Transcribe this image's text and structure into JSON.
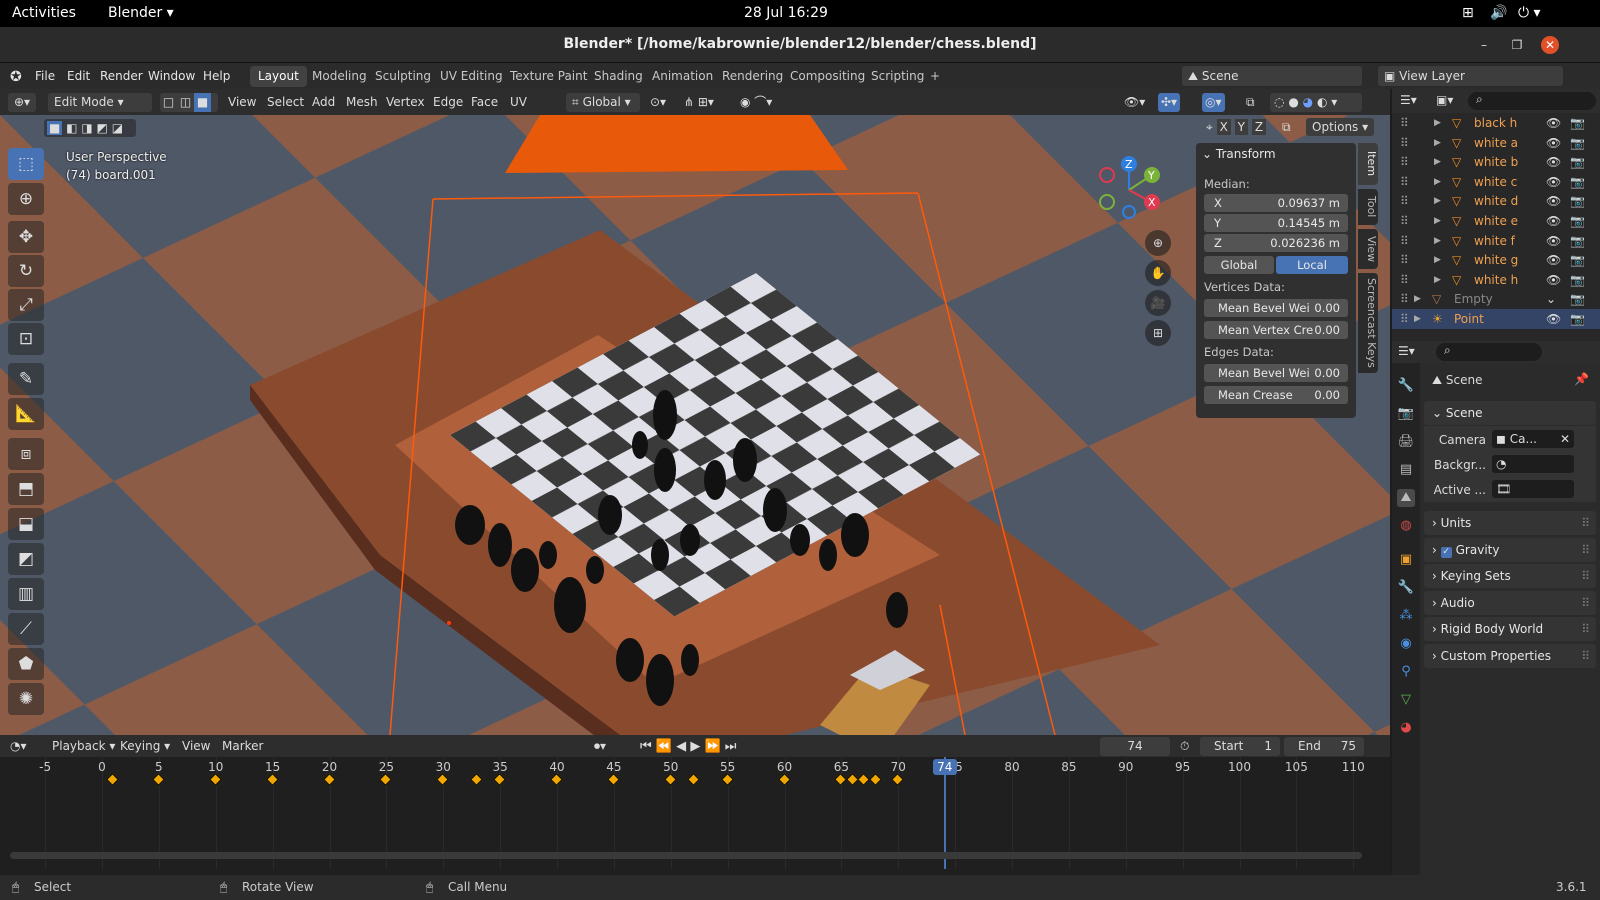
{
  "gnome": {
    "activities": "Activities",
    "app": "Blender ▾",
    "clock": "28 Jul  16:29"
  },
  "title": "Blender* [/home/kabrownie/blender12/blender/chess.blend]",
  "menus": [
    "File",
    "Edit",
    "Render",
    "Window",
    "Help"
  ],
  "workspaces": [
    "Layout",
    "Modeling",
    "Sculpting",
    "UV Editing",
    "Texture Paint",
    "Shading",
    "Animation",
    "Rendering",
    "Compositing",
    "Scripting"
  ],
  "scene_field": "Scene",
  "view_layer_field": "View Layer",
  "header": {
    "mode": "Edit Mode",
    "view": "View",
    "select": "Select",
    "add": "Add",
    "mesh": "Mesh",
    "vertex": "Vertex",
    "edge": "Edge",
    "face": "Face",
    "uv": "UV",
    "orientation": "Global",
    "options": "Options",
    "x": "X",
    "y": "Y",
    "z": "Z"
  },
  "viewport": {
    "perspective": "User Perspective",
    "object": "(74) board.001"
  },
  "npanel": {
    "title": "Transform",
    "median": "Median:",
    "x_label": "X",
    "x_value": "0.09637 m",
    "y_label": "Y",
    "y_value": "0.14545 m",
    "z_label": "Z",
    "z_value": "0.026236 m",
    "global": "Global",
    "local": "Local",
    "vertices_data": "Vertices Data:",
    "v_bevel": "Mean Bevel Wei",
    "v_bevel_val": "0.00",
    "v_crease": "Mean Vertex Cre",
    "v_crease_val": "0.00",
    "edges_data": "Edges Data:",
    "e_bevel": "Mean Bevel Wei",
    "e_bevel_val": "0.00",
    "e_crease": "Mean Crease",
    "e_crease_val": "0.00"
  },
  "sidetabs": [
    "Item",
    "Tool",
    "View",
    "Screencast Keys"
  ],
  "outliner": [
    {
      "name": "black h"
    },
    {
      "name": "white a"
    },
    {
      "name": "white b"
    },
    {
      "name": "white c"
    },
    {
      "name": "white d"
    },
    {
      "name": "white e"
    },
    {
      "name": "white f"
    },
    {
      "name": "white g"
    },
    {
      "name": "white h"
    },
    {
      "name": "Empty"
    },
    {
      "name": "Point"
    }
  ],
  "props": {
    "header": "Scene",
    "section": "Scene",
    "camera_label": "Camera",
    "camera_value": "Ca...",
    "background_label": "Backgr...",
    "active_label": "Active ...",
    "sections": [
      "Units",
      "Gravity",
      "Keying Sets",
      "Audio",
      "Rigid Body World",
      "Custom Properties"
    ]
  },
  "timeline": {
    "playback": "Playback",
    "keying": "Keying",
    "view": "View",
    "marker": "Marker",
    "current_frame": "74",
    "start_label": "Start",
    "start": "1",
    "end_label": "End",
    "end": "75",
    "ticks": [
      "-5",
      "0",
      "5",
      "10",
      "15",
      "20",
      "25",
      "30",
      "35",
      "40",
      "45",
      "50",
      "55",
      "60",
      "65",
      "70",
      "75",
      "80",
      "85",
      "90",
      "95",
      "100",
      "105",
      "110"
    ],
    "keyframes": [
      1,
      5,
      10,
      15,
      20,
      25,
      30,
      33,
      35,
      40,
      45,
      50,
      52,
      55,
      60,
      65,
      66,
      67,
      68,
      70
    ]
  },
  "status": {
    "select": "Select",
    "rotate": "Rotate View",
    "call_menu": "Call Menu",
    "version": "3.6.1"
  }
}
